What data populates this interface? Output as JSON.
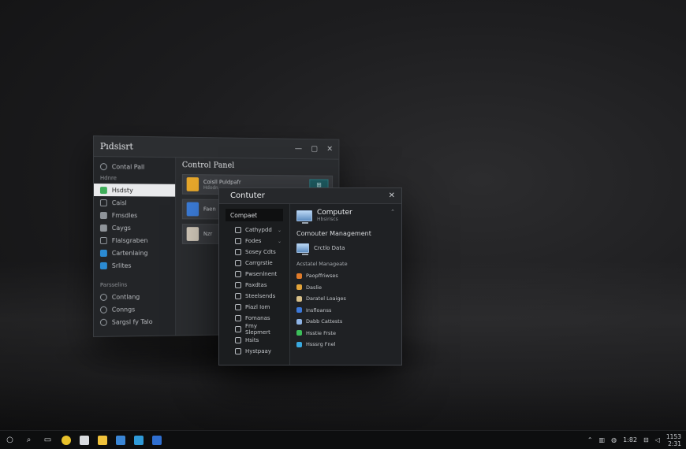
{
  "back_window": {
    "title": "Pıdsisrt",
    "controls": [
      "—",
      "▢",
      "✕"
    ],
    "sidebar": {
      "top_item": "Contal Pall",
      "section_label": "Hdnre",
      "items": [
        {
          "label": "Hsdsty",
          "color": "#3fae5a",
          "selected": true
        },
        {
          "label": "Caisl",
          "color": "#8f949a"
        },
        {
          "label": "Fmsdles",
          "color": "#8f949a"
        },
        {
          "label": "Caygs",
          "color": "#8f949a"
        },
        {
          "label": "Flalsgraben",
          "color": "#8f949a"
        },
        {
          "label": "Cartenlaing",
          "color": "#2b8bd3"
        },
        {
          "label": "Srlites",
          "color": "#2b8bd3"
        }
      ],
      "section2_label": "Parsselins",
      "items2": [
        {
          "label": "Contlang"
        },
        {
          "label": "Conngs"
        },
        {
          "label": "Sargsl fy Talo"
        }
      ]
    },
    "main": {
      "heading": "Control Panel",
      "cards": [
        {
          "title": "Coisll Puldpafr",
          "sub": "Hdodn",
          "color": "#e6a72b",
          "action": "⊞"
        },
        {
          "title": "Faen",
          "sub": "",
          "color": "#3b7bd6"
        },
        {
          "title": "Nzr",
          "sub": "",
          "color": "#d0c7b8"
        }
      ]
    }
  },
  "front_window": {
    "title": "Contuter",
    "close": "✕",
    "sidebar": {
      "head": "Compaet",
      "items": [
        {
          "label": "Cathypdd",
          "has_caret": true
        },
        {
          "label": "Fodes",
          "has_caret": true
        },
        {
          "label": "Sosey Cdts"
        },
        {
          "label": "Carrgrstie"
        },
        {
          "label": "Pwsenlnent"
        },
        {
          "label": "Paxdtas"
        },
        {
          "label": "Steelsends"
        },
        {
          "label": "Piazl Iom"
        },
        {
          "label": "Fomanas"
        },
        {
          "label": "Fmy Slepmert"
        },
        {
          "label": "Hsits"
        },
        {
          "label": "Hystpaay"
        }
      ]
    },
    "main": {
      "title": "Computer",
      "subtitle": "Hbsiriscs",
      "section": "Comouter Management",
      "shortcut": "Crctlo Data",
      "group_label": "Acstatel Manageate",
      "list": [
        {
          "label": "Paopffriwses",
          "color": "#e07b2a"
        },
        {
          "label": "Daslie",
          "color": "#e3a43a"
        },
        {
          "label": "Daratel Loaiges",
          "color": "#d8c08a"
        },
        {
          "label": "Insfloanss",
          "color": "#3c78d8"
        },
        {
          "label": "Dabb Cattests",
          "color": "#8fb4e6"
        },
        {
          "label": "Hsstie Frste",
          "color": "#3cbf5a"
        },
        {
          "label": "Hsssrg Fnel",
          "color": "#39a9e0"
        }
      ]
    }
  },
  "taskbar": {
    "start_icon": "start-icon",
    "apps": [
      {
        "name": "search-icon",
        "glyph": "⌕",
        "color": ""
      },
      {
        "name": "task-view-icon",
        "glyph": "▭",
        "color": ""
      },
      {
        "name": "chrome-icon",
        "color": "#e8c12b"
      },
      {
        "name": "notepad-icon",
        "color": "#d9dce0"
      },
      {
        "name": "folder-icon",
        "color": "#f0c23b"
      },
      {
        "name": "store-icon",
        "color": "#3a86d6"
      },
      {
        "name": "edge-icon",
        "color": "#2f9ad8"
      },
      {
        "name": "word-icon",
        "color": "#2f6fd0"
      }
    ],
    "tray": [
      "⌃",
      "▥",
      "◍",
      "1:82",
      "⊟",
      "◁"
    ],
    "time": "1153",
    "date": "2:31"
  }
}
